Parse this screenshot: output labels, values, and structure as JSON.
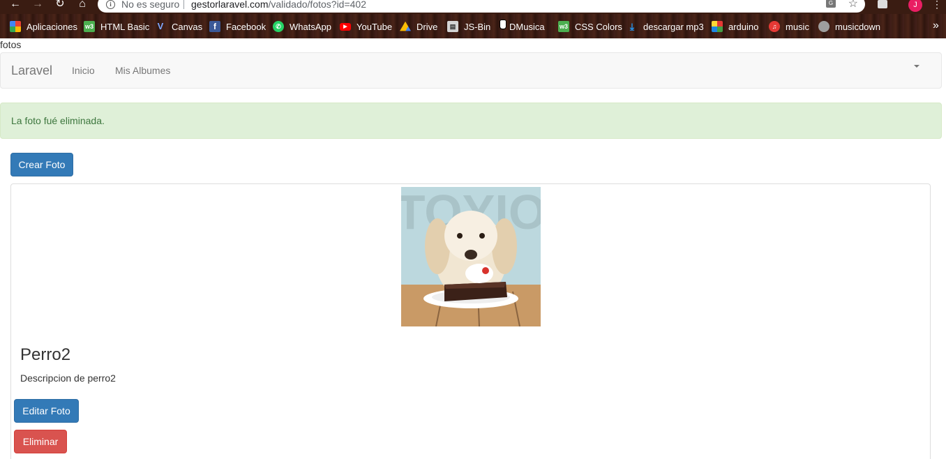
{
  "browser": {
    "omnibox": {
      "security": "No es seguro",
      "host": "gestorlaravel.com",
      "path": "/validado/fotos?id=402"
    },
    "avatar_letter": "J",
    "bookmarks": [
      {
        "label": "Aplicaciones",
        "icon": "apps-grid-icon",
        "color": "#f4b400"
      },
      {
        "label": "HTML Basic",
        "icon": "w3-icon",
        "color": "#4caf50"
      },
      {
        "label": "Canvas",
        "icon": "canvas-icon",
        "color": "#5c7cfa"
      },
      {
        "label": "Facebook",
        "icon": "facebook-icon",
        "color": "#3b5998"
      },
      {
        "label": "WhatsApp",
        "icon": "whatsapp-icon",
        "color": "#25d366"
      },
      {
        "label": "YouTube",
        "icon": "youtube-icon",
        "color": "#ff0000"
      },
      {
        "label": "Drive",
        "icon": "drive-icon",
        "color": "#fbbc05"
      },
      {
        "label": "JS-Bin",
        "icon": "jsbin-icon",
        "color": "#6d8eb8"
      },
      {
        "label": "DMusica",
        "icon": "dmusica-icon",
        "color": "#888888"
      },
      {
        "label": "CSS Colors",
        "icon": "w3-icon",
        "color": "#4caf50"
      },
      {
        "label": "descargar mp3",
        "icon": "download-icon",
        "color": "#2196f3"
      },
      {
        "label": "arduino",
        "icon": "arduino-icon",
        "color": "#e53935"
      },
      {
        "label": "music",
        "icon": "music-icon",
        "color": "#e53935"
      },
      {
        "label": "musicdown",
        "icon": "musicdown-icon",
        "color": "#9e9e9e"
      }
    ]
  },
  "page": {
    "label": "fotos",
    "navbar": {
      "brand": "Laravel",
      "links": [
        "Inicio",
        "Mis Albumes"
      ]
    },
    "alert": "La foto fué eliminada.",
    "create_button": "Crear Foto",
    "photo": {
      "title": "Perro2",
      "description": "Descripcion de perro2",
      "edit_button": "Editar Foto",
      "delete_button": "Eliminar"
    }
  },
  "colors": {
    "primary": "#337ab7",
    "danger": "#d9534f",
    "success_bg": "#dff0d8",
    "success_text": "#3c763d"
  }
}
